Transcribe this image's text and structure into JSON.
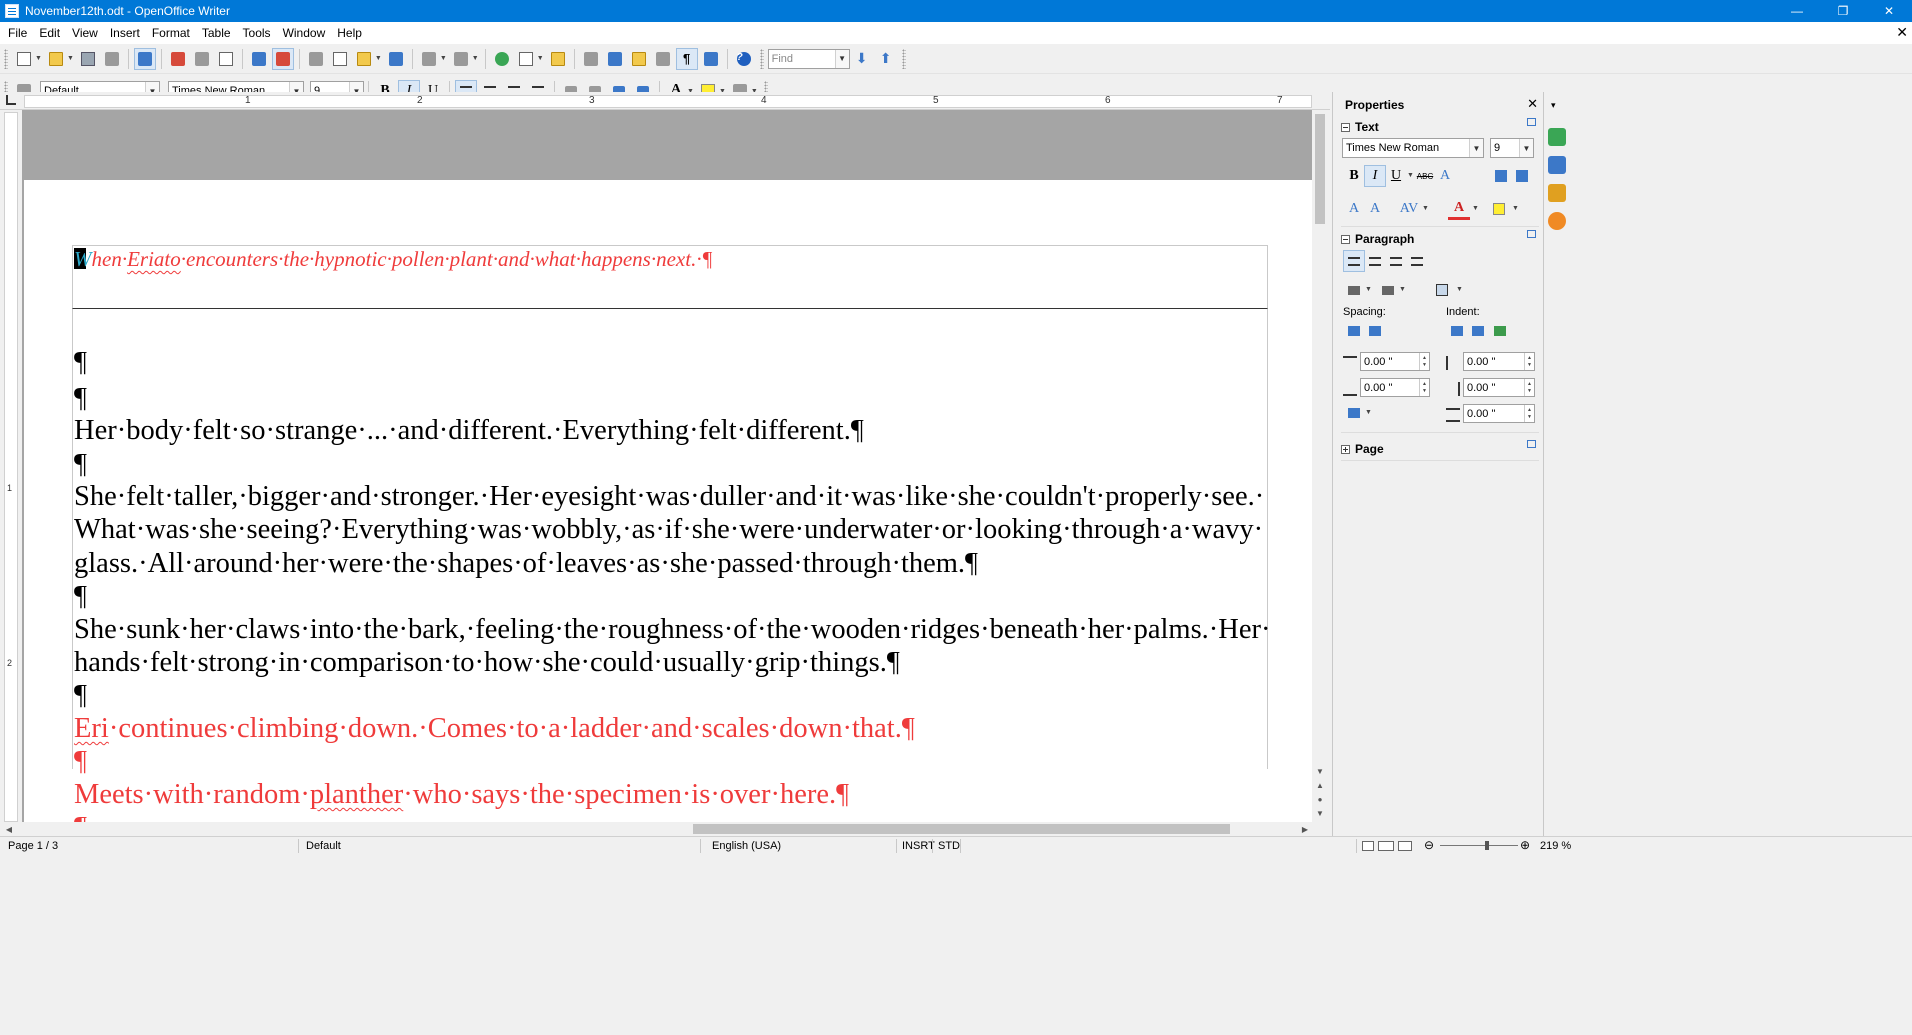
{
  "window": {
    "title": "November12th.odt - OpenOffice Writer",
    "minimize": "—",
    "maximize": "❐",
    "close": "✕"
  },
  "menubar": {
    "items": [
      "File",
      "Edit",
      "View",
      "Insert",
      "Format",
      "Table",
      "Tools",
      "Window",
      "Help"
    ],
    "doc_close": "✕"
  },
  "toolbar": {
    "find_placeholder": "Find",
    "paragraph_style": "Default",
    "font_name": "Times New Roman",
    "font_size": "9",
    "bold": "B",
    "italic": "I",
    "underline": "U"
  },
  "ruler": {
    "marks": [
      "1",
      "2",
      "3",
      "4",
      "5",
      "6",
      "7"
    ],
    "vmarks": [
      "1",
      "2"
    ]
  },
  "document": {
    "header_line": "When·Eriato·encounters·the·hypnotic·pollen·plant·and·what·happens·next.·¶",
    "header_first_letter": "W",
    "header_word_eriato": "Eriato",
    "header_pilcrow": "¶",
    "paragraphs": [
      {
        "text": "¶",
        "color": "#000000"
      },
      {
        "text": "Her·body·felt·so·strange·...·and·different.·Everything·felt·different.¶",
        "color": "#000000"
      },
      {
        "text": "¶",
        "color": "#000000"
      },
      {
        "text": "She·felt·taller,·bigger·and·stronger.·Her·eyesight·was·duller·and·it·was·like·she·couldn't·properly·see.·",
        "color": "#000000"
      },
      {
        "text": "What·was·she·seeing?·Everything·was·wobbly,·as·if·she·were·underwater·or·looking·through·a·wavy·",
        "color": "#000000"
      },
      {
        "text": "glass.·All·around·her·were·the·shapes·of·leaves·as·she·passed·through·them.¶",
        "color": "#000000"
      },
      {
        "text": "¶",
        "color": "#000000"
      },
      {
        "text": "She·sunk·her·claws·into·the·bark,·feeling·the·roughness·of·the·wooden·ridges·beneath·her·palms.·Her·",
        "color": "#000000"
      },
      {
        "text": "hands·felt·strong·in·comparison·to·how·she·could·usually·grip·things.¶",
        "color": "#000000"
      },
      {
        "text": "¶",
        "color": "#000000"
      },
      {
        "text": "Eri·continues·climbing·down.·Comes·to·a·ladder·and·scales·down·that.¶",
        "color": "#ef3b3b"
      },
      {
        "text": "¶",
        "color": "#ef3b3b"
      },
      {
        "text": "Meets·with·random·planther·who·says·the·specimen·is·over·here.¶",
        "color": "#ef3b3b"
      },
      {
        "text": "¶",
        "color": "#ef3b3b"
      }
    ],
    "empty_pilcrow": "¶"
  },
  "sidebar": {
    "title": "Properties",
    "close": "✕",
    "text_section": "Text",
    "font_name": "Times New Roman",
    "font_size": "9",
    "bold": "B",
    "italic": "I",
    "underline": "U",
    "strike": "ABC",
    "paragraph_section": "Paragraph",
    "spacing_label": "Spacing:",
    "indent_label": "Indent:",
    "spacing_above": "0.00 \"",
    "spacing_below": "0.00 \"",
    "indent_before": "0.00 \"",
    "indent_after": "0.00 \"",
    "indent_first": "0.00 \"",
    "page_section": "Page"
  },
  "statusbar": {
    "page": "Page 1 / 3",
    "style": "Default",
    "language": "English (USA)",
    "insert_mode": "INSRT",
    "selection_mode": "STD",
    "zoom": "219 %"
  },
  "colors": {
    "titlebar": "#0078d7",
    "red_text": "#ef3b3b",
    "accent_active": "#dbe8f6"
  }
}
